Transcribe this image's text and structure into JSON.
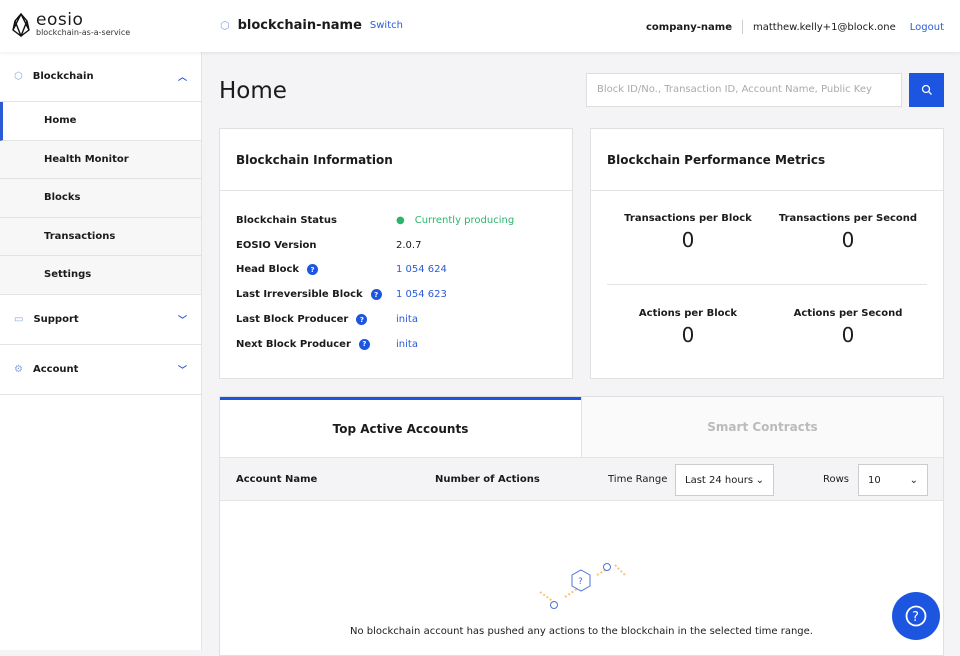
{
  "header": {
    "logo": "eosio",
    "logo_sub": "blockchain-as-a-service",
    "blockchain_name": "blockchain-name",
    "switch": "Switch",
    "company": "company-name",
    "email": "matthew.kelly+1@block.one",
    "logout": "Logout"
  },
  "sidebar": {
    "blockchain": "Blockchain",
    "items": [
      "Home",
      "Health Monitor",
      "Blocks",
      "Transactions",
      "Settings"
    ],
    "support": "Support",
    "account": "Account"
  },
  "page": {
    "title": "Home",
    "search_placeholder": "Block ID/No., Transaction ID, Account Name, Public Key"
  },
  "info": {
    "title": "Blockchain Information",
    "rows": [
      {
        "k": "Blockchain Status",
        "v": "Currently producing"
      },
      {
        "k": "EOSIO Version",
        "v": "2.0.7"
      },
      {
        "k": "Head Block",
        "v": "1 054 624"
      },
      {
        "k": "Last Irreversible Block",
        "v": "1 054 623"
      },
      {
        "k": "Last Block Producer",
        "v": "inita"
      },
      {
        "k": "Next Block Producer",
        "v": "inita"
      }
    ],
    "help": "?"
  },
  "metrics": {
    "title": "Blockchain Performance Metrics",
    "items": [
      {
        "l": "Transactions per Block",
        "n": "0"
      },
      {
        "l": "Transactions per Second",
        "n": "0"
      },
      {
        "l": "Actions per Block",
        "n": "0"
      },
      {
        "l": "Actions per Second",
        "n": "0"
      }
    ]
  },
  "table": {
    "tabs": [
      "Top Active Accounts",
      "Smart Contracts"
    ],
    "col1": "Account Name",
    "col2": "Number of Actions",
    "time_range_label": "Time Range",
    "time_range": "Last 24 hours",
    "rows_label": "Rows",
    "rows": "10",
    "empty": "No blockchain account has pushed any actions to the blockchain in the selected time range.",
    "empty_icon": "?"
  },
  "colors": {
    "accent": "#1c55e0",
    "success": "#2bb56c"
  }
}
